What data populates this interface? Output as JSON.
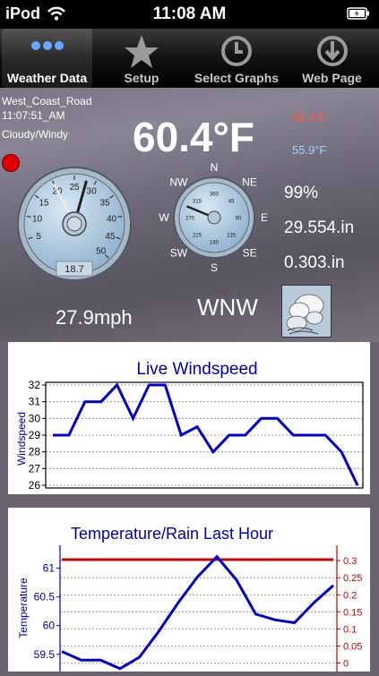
{
  "status": {
    "carrier": "iPod",
    "time": "11:08 AM"
  },
  "tabs": [
    {
      "label": "Weather Data",
      "icon": "dots-icon",
      "active": true
    },
    {
      "label": "Setup",
      "icon": "star-icon",
      "active": false
    },
    {
      "label": "Select Graphs",
      "icon": "clock-icon",
      "active": false
    },
    {
      "label": "Web Page",
      "icon": "download-arrow-icon",
      "active": false
    }
  ],
  "station": {
    "name": "West_Coast_Road",
    "time": "11:07:51_AM",
    "condition": "Cloudy/Windy"
  },
  "weather": {
    "temperature": "60.4°F",
    "high": "61.3°F",
    "low": "55.9°F",
    "humidity": "99%",
    "pressure": "29.554.in",
    "rain": "0.303.in",
    "wind_speed": "27.9mph",
    "wind_direction": "WNW"
  },
  "wind_gauge": {
    "ticks": [
      "5",
      "10",
      "15",
      "20",
      "25",
      "30",
      "35",
      "40",
      "45",
      "50"
    ],
    "readout": "18.7",
    "needle_value": 27.9,
    "max_value": 50
  },
  "compass": {
    "points": [
      "N",
      "NE",
      "E",
      "SE",
      "S",
      "SW",
      "W",
      "NW"
    ],
    "inner_ticks": [
      "360",
      "45",
      "90",
      "135",
      "180",
      "225",
      "270",
      "315"
    ],
    "direction_degrees": 292.5
  },
  "colors": {
    "series": "#0000cc",
    "temp_line": "#cc0000",
    "rain_axis": "#cc0000",
    "high_temp": "#ff5a3c",
    "low_temp": "#9cd4ff"
  },
  "chart_data": [
    {
      "type": "line",
      "title": "Live Windspeed",
      "ylabel": "Windspeed",
      "ylim": [
        26,
        32
      ],
      "yticks": [
        "26",
        "27",
        "28",
        "29",
        "30",
        "31",
        "32"
      ],
      "values": [
        29,
        29,
        31,
        31,
        32,
        30,
        32,
        32,
        29,
        29.5,
        28,
        29,
        29,
        30,
        30,
        29,
        29,
        29,
        28,
        26
      ]
    },
    {
      "type": "line",
      "title": "Temperature/Rain Last Hour",
      "ylabel": "Temperature",
      "ylim": [
        59.2,
        61.4
      ],
      "yticks": [
        "59.5",
        "60",
        "60.5",
        "61"
      ],
      "y2ticks": [
        "0",
        "0.05",
        "0.1",
        "0.15",
        "0.2",
        "0.25",
        "0.3"
      ],
      "y2lim": [
        -0.025,
        0.345
      ],
      "series": [
        {
          "values": [
            59.55,
            59.4,
            59.4,
            59.25,
            59.45,
            59.9,
            60.4,
            60.85,
            61.2,
            60.8,
            60.2,
            60.1,
            60.05,
            60.4,
            60.7
          ]
        },
        {
          "values": [
            0.303,
            0.303,
            0.303,
            0.303,
            0.303,
            0.303,
            0.303,
            0.303,
            0.303,
            0.303,
            0.303,
            0.303,
            0.303,
            0.303,
            0.303
          ]
        }
      ]
    }
  ]
}
